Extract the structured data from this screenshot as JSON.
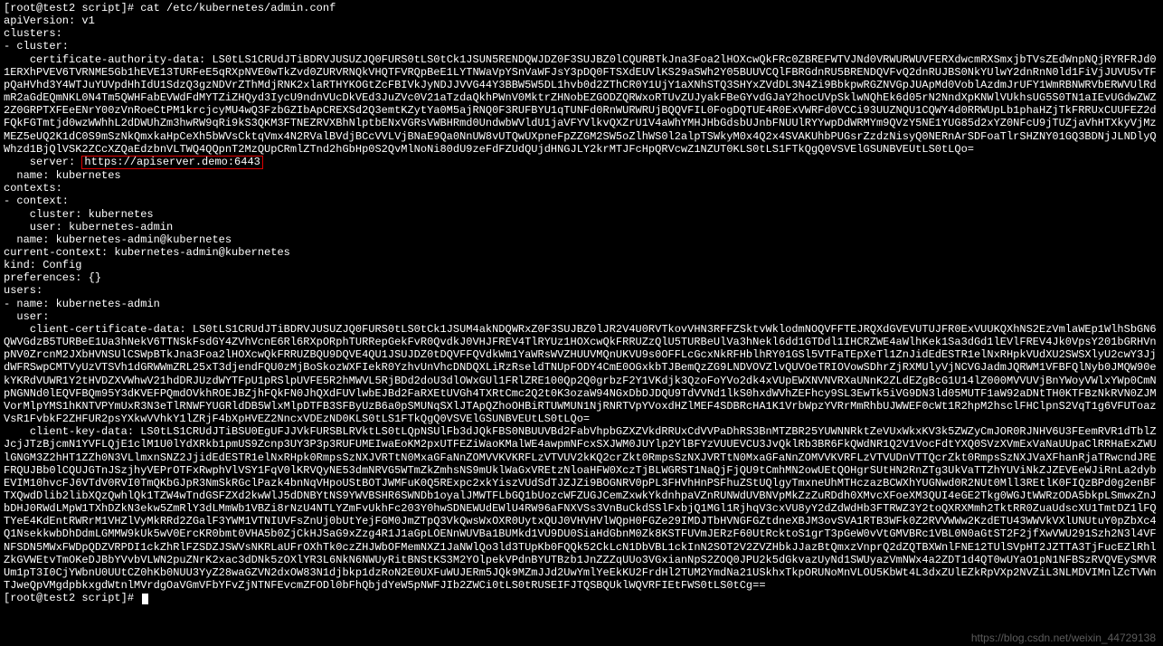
{
  "prompt": "[root@test2 script]# ",
  "command": "cat /etc/kubernetes/admin.conf",
  "yaml": {
    "apiVersion": "apiVersion: v1",
    "clusters": "clusters:",
    "cluster_item": "- cluster:",
    "cert_key": "    certificate-authority-data: ",
    "cert_val": "LS0tLS1CRUdJTiBDRVJUSUZJQ0FURS0tLS0tCk1JSUN5RENDQWJDZ0F3SUJBZ0lCQURBTkJna3Foa2lHOXcwQkFRc0ZBREFWTVJNd0VRWURWUVFERXdwcmRXSmxjbTVsZEdWnpNQjRYRFRJd01ERXhPVEV6TVRNME5Gb1hEVE13TURFeE5qRXpNVE0wTkZvd0ZURVRNQkVHQTFVRQpBeE1LYTNWaVpYSnVaWFJsY3pDQ0FTSXdEUVlKS29aSWh2Y05BUUVCQlFBRGdnRU5BRENDQVFvQ2dnRUJBS0NkYUlwY2dnRnN0ld1FiVjJUVU5vTFpQaHVhd3Y4WTJuYUVpdHhIdU1SdzQ3gzNDVrZThMdjRNK2xlaRTHYKOGtZcFBIVkJyNDJJVVG44Y3BBW5W5DL1hvb0d2ZThCR0Y1UjY1aXNhSTQ3SHYxZVdDL3N4Zi9BbkpwRGZNVGpJUApMd0VoblAzdmJrUFY1WmRBNWRVbERWVUlRdmR2aGdEQmNKL0N4Tm5QWHFabEVWdFdMYTZiZHQyd3IycU9ndnVUcDkVEd3JuZVc0V21aTzdaQkhPWnV0MktrZHNobEZGODZQRWxoRTUvZUJyakFBeGYvdGJaY2hocUVpSklwNQhEk6d05rN2NndXpKNWlVUkhsUG5S0TN1aIEvUGdwZWZ2Z0GRPTXFEeENrY00zVnRoeCtPM1krcjcyMU4wQ3FzbGZIbApCREXSd2Q3emtKZytYa0M5ajRNQ0F3RUFBYU1qTUNFd0RnWURWRUjBQQVFIL0FogDQTUE4R0ExVWRFd0VCCi93UUZNQU1CQWY4d0RRWUpLb1phaHZjTkFRRUxCUUFEZ2dFQkFGTmtjd0wzWWhhL2dDWUhZm3hwRW9qRi9kS3QKM3FTNEZRVXBhNlptbENxVGRsVWBHRmd0UndwbWVldU1jaVFYVlkvQXZrU1V4aWhYMHJHbGdsbUJnbFNUUlRYYwpDdWRMYm9QVzY5NE1YUG85d2xYZ0NFcU9jTUZjaVhHTXkyVjMzMEZ5eUQ2K1dC0S9mSzNkQmxkaHpCeXh5bWVsCktqVmx4N2RValBVdjBCcVVLVjBNaE9Qa0NnUW8vUTQwUXpneFpZZGM2SW5oZlhWS0l2alpTSWkyM0x4Q2x4SVAKUhbPUGsrZzdzNisyQ0NERnArSDFoaTlrSHZNY01GQ3BDNjJLNDlyQWhzd1BjQlVSK2ZCcXZQaEdzbnVLTWQ4QQpnT2MzQUpCRmlZTnd2hGbHp0S2QvMlNoNi80dU9zeFdFZUdQUjdHNGJLY2krMTJFcHpQRVcwZ1NZUT0KLS0tLS1FTkQgQ0VSVElGSUNBVEUtLS0tLQo=",
    "server_label": "    server: ",
    "server_value": "https://apiserver.demo:6443",
    "name_kube": "  name: kubernetes",
    "contexts": "contexts:",
    "context_item": "- context:",
    "ctx_cluster": "    cluster: kubernetes",
    "ctx_user": "    user: kubernetes-admin",
    "ctx_name": "  name: kubernetes-admin@kubernetes",
    "current_ctx": "current-context: kubernetes-admin@kubernetes",
    "kind": "kind: Config",
    "prefs": "preferences: {}",
    "users": "users:",
    "user_item": "- name: kubernetes-admin",
    "user_sub": "  user:",
    "client_cert_key": "    client-certificate-data: ",
    "client_cert_val": "LS0tLS1CRUdJTiBDRVJUSUZJQ0FURS0tLS0tCk1JSUM4akNDQWRxZ0F3SUJBZ0lJR2V4U0RVTkovVHN3RFFZSktvWklodmNOQVFFTEJRQXdGVEVUTUJFR0ExVUUKQXhNS2EzVmlaWEp1WlhSbGN6QWVGdzB5TURBeE1Ua3hNekV6TTNSkFsdGY4ZVhVcnE6Rl6RXpORphTURRepGekFvR0QvdkJ0VHJFREV4TlRYUz1HOXcwQkFRRUZzQlU5TURBeUlVa3hNekl6dd1GTDdl1IHCRZWE4aWlhKek1Sa3dGd1lEVlFREV4Jk0VpsY201bGRHVnpNV0ZrcnM2JXbHVNSUlCSWpBTkJna3Foa2lHOXcwQkFRRUZBQU9DQVE4QU1JSUJDZ0tDQVFFQVdkWm1YaWRsWVZHUUVMQnUKVU9s0OFFLcGcxNkRFHblhRY01GSl5VTFaTEpXeTl1ZnJidEdESTR1elNxRHpkVUdXU2SWSXlyU2cwY3JjdWFRSwpCMTVyUzVTSVh1dGRWWmZRL25xT3djendFQU0zMjBoSkozWXFIekR0YzhvUnVhcDNDQXLiRzRseldTNUpFODY4CmE0OGxkbTJBemQzZG9LNDVOVZlvQUVOeTRIOVowSDhrZjRXMUlyVjNCVGJadmJQRWM1VFBFQlNyb0JMQW90ekYKRdVUWR1Y2tHVDZXVWhwV21hdDRJUzdWYTFpU1pRSlpUVFE5R2hMWVL5RjBDd2doU3dlOWxGUl1FRlZRE100Qp2Q0grbzF2Y1VKdjk3QzoFoYVo2dk4xVUpEWXNVNVRXaUNnK2ZLdEZgBcG1U14lZ000MVVUVjBnYWoyVWlxYWp0CmNpNGNNd0lEQVFBQm95Y3dKVEFPQmdOVkhROEJBZjhFQkFN0JhQXdFUVlwbEJBd2FaRXEtUVGh4TXRtCmc2Q2t0K3ozaW94NGxDbDJDQU9TdVVNd1lkS0hxdWVhZEFhcy9SL3EwTk5iVG9DN3ld05MUTF1aW92aDNtTH0KTFBzNkRVN0ZJMVorMlpYMS1hKNTVPYmUxR3N3eTlRNWFYUGRldDB5WlxMlpDTFB3SFByUzB6a0pSMUNqSXlJTApQZhoOHBiRTUWMUN1NjRNRTVpYVoxdHZlMEF4SDBRcHA1K1VrbWpzYVRrMmRhbUJWWEF0cWt1R2hpM2hsclFHClpnS2VqT1g6VFUToazVsR1FvbkF2ZHFUR2psYXkwVVhkY1lZRjF4bXpHVEZ2NncxVDEzND0KLS0tLS1FTkQgQ0VSVElGSUNBVEUtLS0tLQo=",
    "client_key_key": "    client-key-data: ",
    "client_key_val": "LS0tLS1CRUdJTiBSU0EgUFJJVkFURSBLRVktLS0tLQpNSUlFb3dJQkFBS0NBUUVBd2FabVhpbGZXZVkdRRUxCdVVPaDhRS3BnMTZBR25YUWNNRktZeVUxWkxKV3k5ZWZyCmJOR0RJNHV6U3FEemRVR1dTblZJcjJTzBjcmN1YVFLQjE1clM1U0lYdXRkb1pmUS9Zcnp3UY3P3p3RUFUMEIwaEoKM2pxUTFEZiWaoKMalWE4awpmNFcxSXJWM0JUYlp2YlBFYzVUUEVCU3JvQklRb3BR6FkQWdNR1Q2V1VocFdtYXQ0SVzXVmExVaNaUUpaClRRHaExZWUlGNGM3Z2hHT1ZZh0N3VLlmxnSNZ2JjidEdESTR1elNxRHpk0RmpsSzNXJVRTtN0MxaGFaNnZOMVVKVKRFLzVTVUV2kKQ2crZkt0RmpsSzNXJVRTtN0MxaGFaNnZOMVVKVRFLzVTVUDnVTTQcrZkt0RmpsSzNXJVaXFhanRjaTRwcndJREFRQUJBb0lCQUJGTnJSzjhyVEPrOTFxRwphVlVSY1FqV0lKRVQyNE53dmNRVG5WTmZkZmhsNS9mUklWaGxVREtzNloaHFW0XczTjBLWGRST1NaQjFjQU9tCmhMN2owUEtQOHgrSUtHN2RnZTg3UkVaTTZhYUViNkZJZEVEeWJiRnLa2dybEVIM10hvcFJ6VTdV0RVI0TmQKbGJpR3NmSkRGclPazk4bnNqVHpoUStBOTJWMFuK0Q5RExpc2xkYiszVUdSdTJZJZi9BOGNRV0pPL3FHVhHnPSFhuZStUQlgyTmxneUhMTHczazBCWXhYUGNwd0R2NUt0Mll3REtlK0FIQzBPd0g2enBFTXQwdDlib2libXQzQwhlQk1TZW4wTndGSFZXd2kwWlJ5dDNBYtNS9YWVBSHR6SWNDb1oyalJMWTFLbGQ1bUozcWFZUGJCemZxwkYkdnhpaVZnRUNWdUVBNVpMkZzZuRDdh0XMvcXFoeXM3QUI4eGE2Tkg0WGJtWWRzODA5bkpLSmwxZnJbDHJ0RWdLMpW1TXhDZkN3ekw5ZmRlY3dLMmWb1VBZi8rNzU4NTLYZmFvUkhFc203Y0hwSDNEWUdEWlU4RW96aFNXVSs3VnBuCkdSSlFxbjQ1MGl1RjhqV3cxVU8yY2dZdWdHb3FTRWZ3Y2toQXRXMmh2TktRR0ZuaUdscXU1TmtDZ1lFQTYeE4KdEntRWRrM1VHZlVyMkRRd2ZGalF3YWM1VTNIUVFsZnUj0bUtYejFGM0JmZTpQ3VkQwsWxOXR0UytxQUJ0VHVHVlWQpH0FGZe29IMDJTbHVNGFGZtdneXBJM3ovSVA1RTB3WFk0Z2RVVWWw2KzdETU43WWVkVXlUNUtuY0pZbXc4Q1NsekkwbDhDdmLGMMW9kUk5wV0ErcKR0bmt0VHA5b0ZjCkHJSaG9xZzg4R1J1aGpLOENnWUVBa1BUMkd1VU9DU0SiaHdGbnM0Zk8KSTFUVmJERzF60UtRcktoS1grT3pGeW0vVtGMVBRc1VBL0N0aGtST2F2jfXwVWU291Szh2N3l4VFNFSDN5MWxFWDpQDZVRPDI1ckZhRlFZSDZJSWVsNKRLaUFrOXhTk0czZHJWbOFMemNXZ1JaNWlQo3ld3TUpKb0FQQk52CkLcN1DbVBL1ckInN2SOT2V2ZVZHbkJJazBtQmxzVnprQ2dZQTBXWnlFNE12TUlSVpHT2JZTTA3TjFucEZlRhlZkGVWEtvTmOKeDJBbYVvbVLWN2puZNrK2xac3dDNk5zOXlYR3L6NkN6NWUyRitBNStKS3M2YOlpekVPdnBYUTBzb1JnZZZqUUo3VGxianNpS2ZOQ0JPU2k5dGkvazUyNd1SWUyazVmNWx4a2ZDT1d4QT0wUYaO1pN1NFBSzRVQVEySMVRUm1pT3I0CjYWbnU0UUtCZ0hKb0NUU3YyZ28waGZVN2dxOW83N1djbkp1dzRoN2E0UXFuWUJERm5JQk9MZmJJd2UwYmlYeEkKU2FrdHl2TUM2YmdNa21USkhxTkpORUNoMnVLOU5KbWt4L3dxZUlEZkRpVXp2NVZiL3NLMDVIMnlZcTVWnTJweQpVMgdpbkxgdWtnlMVrdgOaVGmVFbYFvZjNTNFEvcmZFODl0bFhQbjdYeW5pNWFJIb2ZWCi0tLS0tRUSEIFJTQSBQUklWQVRFIEtFWS0tLS0tCg=="
  },
  "next_prompt": "[root@test2 script]# ",
  "watermark": "https://blog.csdn.net/weixin_44729138"
}
